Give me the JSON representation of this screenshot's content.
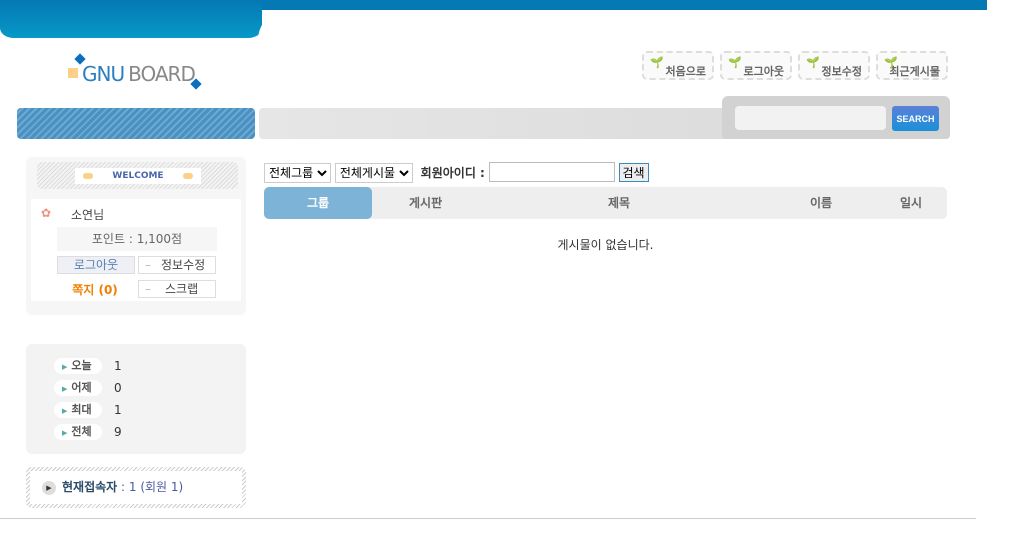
{
  "logo": {
    "text1": "GNU",
    "text2": "BOARD"
  },
  "top_nav": [
    {
      "label": "처음으로"
    },
    {
      "label": "로그아웃"
    },
    {
      "label": "정보수정"
    },
    {
      "label": "최근게시물"
    }
  ],
  "search": {
    "button": "SEARCH",
    "value": ""
  },
  "welcome": {
    "title": "WELCOME",
    "user": "소연님",
    "points_label": "포인트 :",
    "points": "1,100점",
    "logout": "로그아웃",
    "edit": "정보수정",
    "memo": "쪽지 (0)",
    "scrap": "스크랩"
  },
  "stats": [
    {
      "label": "오늘",
      "value": "1"
    },
    {
      "label": "어제",
      "value": "0"
    },
    {
      "label": "최대",
      "value": "1"
    },
    {
      "label": "전체",
      "value": "9"
    }
  ],
  "connect": {
    "label": "현재접속자",
    "count": ": 1 (회원 1)"
  },
  "filter": {
    "group_select": "전체그룹",
    "board_select": "전체게시물",
    "member_label": "회원아이디 :",
    "member_value": "",
    "search_btn": "검색"
  },
  "table": {
    "headers": [
      "그룹",
      "게시판",
      "제목",
      "이름",
      "일시"
    ],
    "empty": "게시물이 없습니다."
  }
}
